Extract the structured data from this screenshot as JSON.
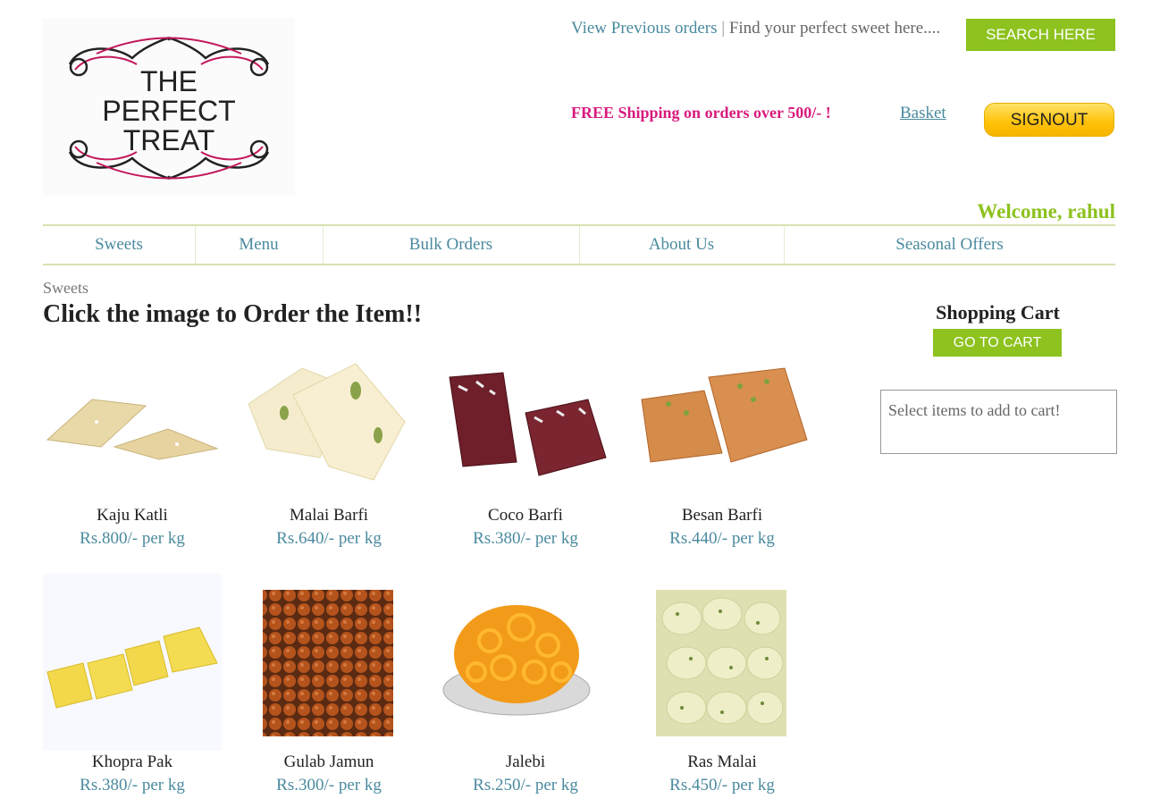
{
  "brand": {
    "logo_line1": "THE",
    "logo_line2": "PERFECT",
    "logo_line3": "TREAT"
  },
  "header": {
    "prev_orders": "View Previous orders",
    "separator": "|",
    "search_prompt": "Find your perfect sweet here....",
    "search_button": "SEARCH HERE",
    "free_shipping": "FREE Shipping on orders over 500/- !",
    "basket": "Basket",
    "signout": "SIGNOUT",
    "welcome": "Welcome, rahul"
  },
  "nav": [
    {
      "label": "Sweets"
    },
    {
      "label": "Menu"
    },
    {
      "label": "Bulk Orders"
    },
    {
      "label": "About Us"
    },
    {
      "label": "Seasonal Offers"
    }
  ],
  "main": {
    "breadcrumb": "Sweets",
    "heading": "Click the image to Order the Item!!",
    "products": [
      {
        "name": "Kaju Katli",
        "price": "Rs.800/- per kg"
      },
      {
        "name": "Malai Barfi",
        "price": "Rs.640/- per kg"
      },
      {
        "name": "Coco Barfi",
        "price": "Rs.380/- per kg"
      },
      {
        "name": "Besan Barfi",
        "price": "Rs.440/- per kg"
      },
      {
        "name": "Khopra Pak",
        "price": "Rs.380/- per kg"
      },
      {
        "name": "Gulab Jamun",
        "price": "Rs.300/- per kg"
      },
      {
        "name": "Jalebi",
        "price": "Rs.250/- per kg"
      },
      {
        "name": "Ras Malai",
        "price": "Rs.450/- per kg"
      }
    ]
  },
  "cart": {
    "title": "Shopping Cart",
    "button": "GO TO CART",
    "empty_message": "Select items to add to cart!"
  },
  "colors": {
    "accent_green": "#8dc21f",
    "link_teal": "#4a8a9e",
    "promo_pink": "#d81b7d",
    "signout_yellow": "#ffc107"
  }
}
